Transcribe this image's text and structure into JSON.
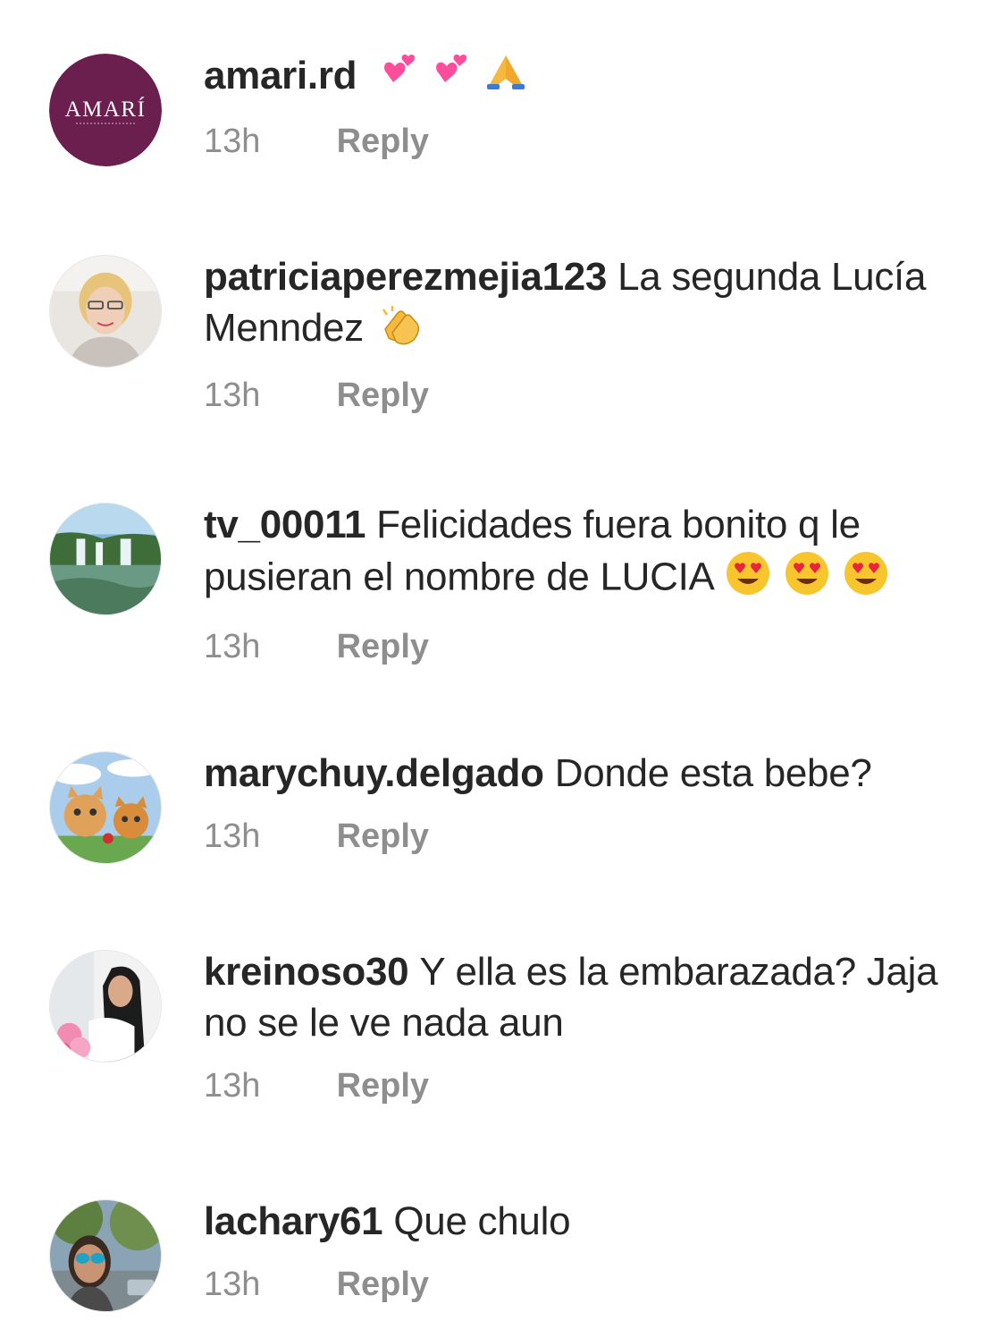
{
  "comments": [
    {
      "username": "amari.rd",
      "text": "",
      "emoji": [
        "two-hearts-icon",
        "two-hearts-icon",
        "folded-hands-icon"
      ],
      "time": "13h",
      "reply": "Reply",
      "avatar": "amari-logo",
      "avatar_text": "AMARÍ"
    },
    {
      "username": "patriciaperezmejia123",
      "text": "La segunda Lucía Menndez",
      "emoji": [
        "clapping-hands-icon"
      ],
      "time": "13h",
      "reply": "Reply",
      "avatar": "woman-glasses-photo"
    },
    {
      "username": "tv_00011",
      "text": "Felicidades fuera bonito q le pusieran el nombre de LUCIA",
      "emoji": [
        "heart-eyes-icon",
        "heart-eyes-icon",
        "heart-eyes-icon"
      ],
      "time": "13h",
      "reply": "Reply",
      "avatar": "waterfall-photo"
    },
    {
      "username": "marychuy.delgado",
      "text": "Donde esta bebe?",
      "emoji": [],
      "time": "13h",
      "reply": "Reply",
      "avatar": "kittens-photo"
    },
    {
      "username": "kreinoso30",
      "text": "Y ella es la embarazada? Jaja no se le ve nada aun",
      "emoji": [],
      "time": "13h",
      "reply": "Reply",
      "avatar": "woman-flowers-photo"
    },
    {
      "username": "lachary61",
      "text": "Que chulo",
      "emoji": [],
      "time": "13h",
      "reply": "Reply",
      "avatar": "woman-sunglasses-photo"
    }
  ],
  "colors": {
    "text": "#262626",
    "secondary": "#8e8e8e",
    "amari_brand": "#6b1f4f"
  }
}
